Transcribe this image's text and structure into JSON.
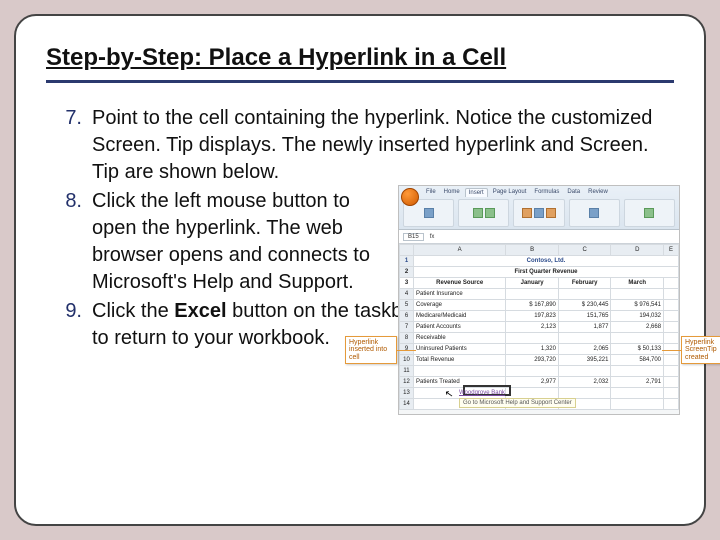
{
  "title": "Step-by-Step: Place a Hyperlink in a Cell",
  "steps": {
    "s7": {
      "num": "7.",
      "text": "Point to the cell containing the hyperlink. Notice the customized Screen. Tip displays. The newly inserted hyperlink and Screen. Tip are shown below."
    },
    "s8": {
      "num": "8.",
      "text_a": "Click the left mouse button to open the hyperlink. The web browser opens and connects to Microsoft's Help and Support."
    },
    "s9": {
      "num": "9.",
      "text_a": "Click the ",
      "bold": "Excel",
      "text_b": " button on the taskbar to return to your workbook."
    }
  },
  "excel": {
    "tabs": [
      "File",
      "Home",
      "Insert",
      "Page Layout",
      "Formulas",
      "Data",
      "Review"
    ],
    "namebox": "B15",
    "fx": "fx",
    "cols": [
      "",
      "A",
      "B",
      "C",
      "D",
      "E"
    ],
    "title1": "Contoso, Ltd.",
    "title2": "First Quarter Revenue",
    "months": [
      "January",
      "February",
      "March"
    ],
    "rows": [
      {
        "n": "3",
        "label": "Revenue Source"
      },
      {
        "n": "4",
        "label": "Patient Insurance",
        "v": [
          "",
          "",
          ""
        ]
      },
      {
        "n": "5",
        "label": "Coverage",
        "v": [
          "$ 167,890",
          "$ 230,445",
          "$ 976,541"
        ]
      },
      {
        "n": "6",
        "label": "Medicare/Medicaid",
        "v": [
          "197,823",
          "151,765",
          "194,032"
        ]
      },
      {
        "n": "7",
        "label": "Patient Accounts",
        "v": [
          "2,123",
          "1,877",
          "2,668"
        ]
      },
      {
        "n": "8",
        "label": "Receivable",
        "v": [
          "",
          "",
          ""
        ]
      },
      {
        "n": "9",
        "label": "Uninsured Patients",
        "v": [
          "1,320",
          "2,065",
          "$ 50,133"
        ]
      },
      {
        "n": "10",
        "label": "Total Revenue",
        "v": [
          "293,720",
          "395,221",
          "584,700"
        ]
      },
      {
        "n": "11",
        "label": "",
        "v": [
          "",
          "",
          ""
        ]
      },
      {
        "n": "12",
        "label": "Patients Treated",
        "v": [
          "2,977",
          "2,032",
          "2,791"
        ]
      }
    ],
    "callout_left": "Hyperlink inserted into cell",
    "callout_right": "Hyperlink ScreenTip created",
    "linktext": "Woodgrove Bank",
    "linkbar": "Go to Microsoft Help and Support Center"
  }
}
